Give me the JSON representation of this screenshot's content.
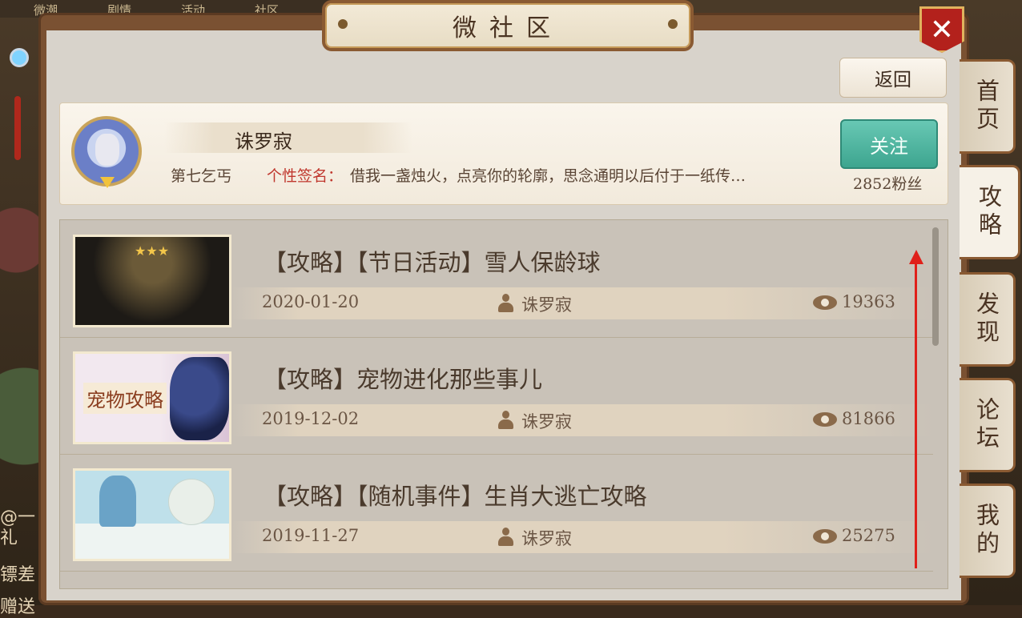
{
  "window": {
    "title": "微社区",
    "close_label": "✕"
  },
  "background": {
    "top_tabs": [
      "微潮",
      "剧情",
      "活动",
      "社区"
    ],
    "left_texts": [
      "@一",
      "礼",
      "镖差",
      "赠送"
    ]
  },
  "toolbar": {
    "back_label": "返回"
  },
  "profile": {
    "name": "诛罗寂",
    "rank": "第七乞丐",
    "signature_label": "个性签名：",
    "signature_text": "借我一盏烛火，点亮你的轮廓，思念通明以后付于一纸传…",
    "follow_label": "关注",
    "fans": "2852粉丝"
  },
  "thumbnails": {
    "t1_stars": "★★★",
    "t2_label": "宠物攻略"
  },
  "posts": [
    {
      "title": "【攻略】【节日活动】雪人保龄球",
      "date": "2020-01-20",
      "author": "诛罗寂",
      "views": "19363"
    },
    {
      "title": "【攻略】宠物进化那些事儿",
      "date": "2019-12-02",
      "author": "诛罗寂",
      "views": "81866"
    },
    {
      "title": "【攻略】【随机事件】生肖大逃亡攻略",
      "date": "2019-11-27",
      "author": "诛罗寂",
      "views": "25275"
    }
  ],
  "tabs": [
    {
      "label": "首页",
      "active": false
    },
    {
      "label": "攻略",
      "active": true
    },
    {
      "label": "发现",
      "active": false
    },
    {
      "label": "论坛",
      "active": false
    },
    {
      "label": "我的",
      "active": false
    }
  ],
  "colors": {
    "accent_red": "#e0201a",
    "follow_green": "#3da58f",
    "signature_red": "#c0382e"
  }
}
